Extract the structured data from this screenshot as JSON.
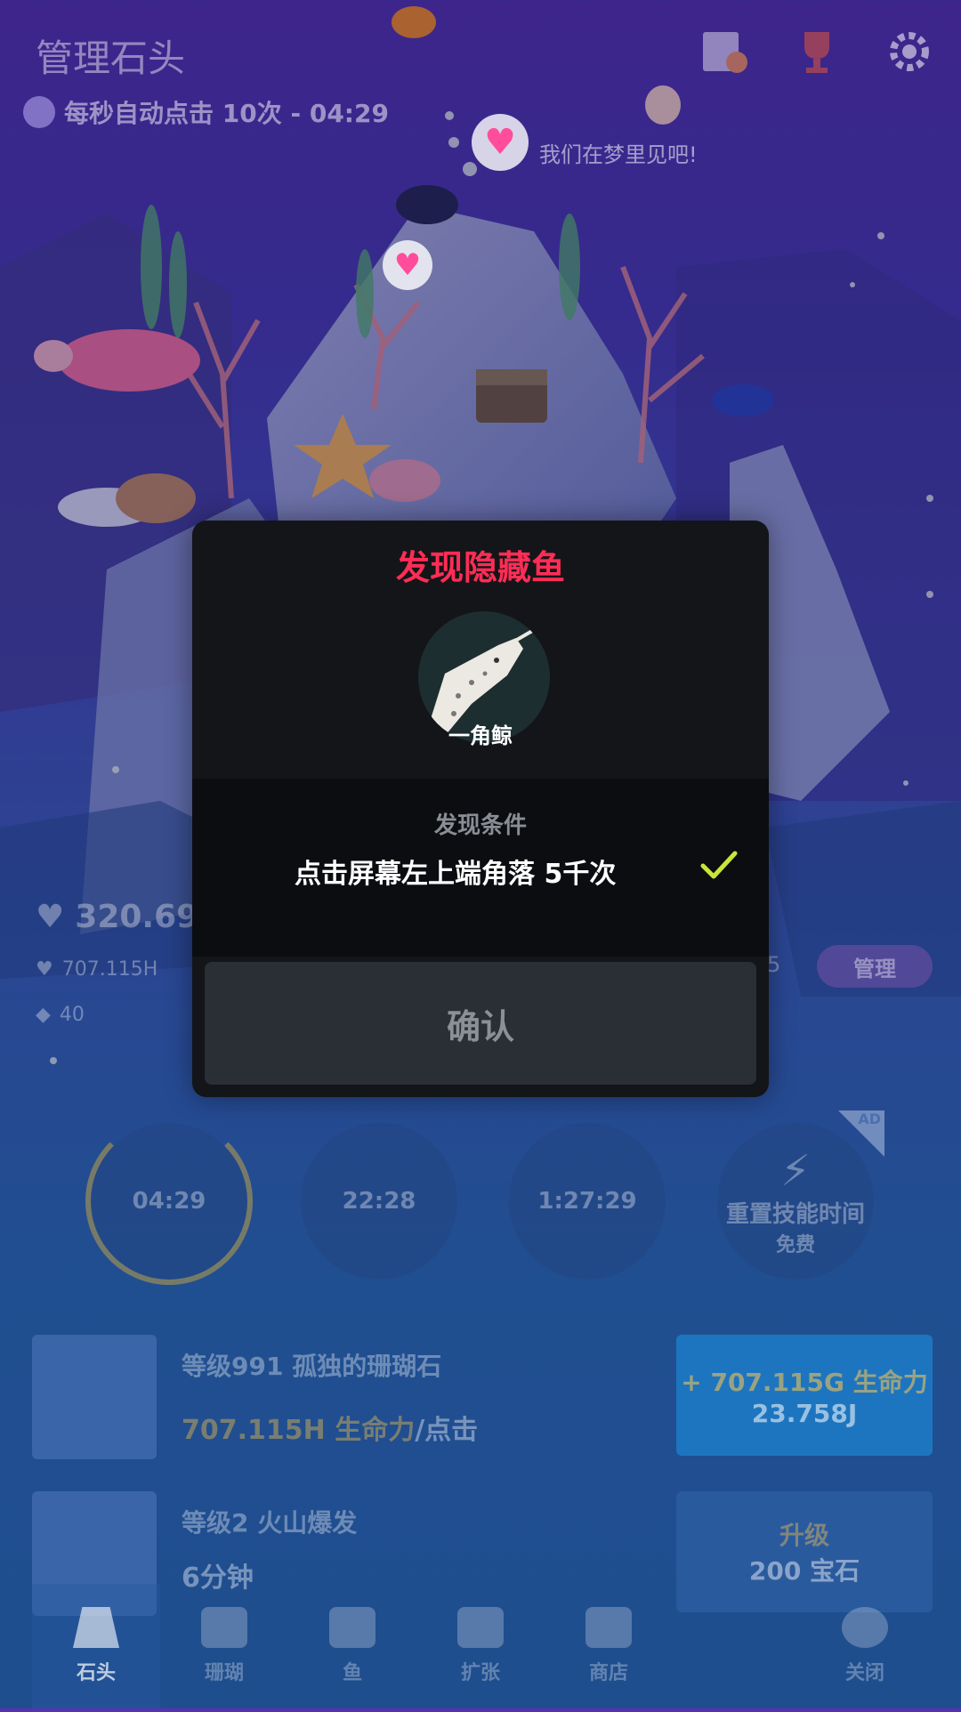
{
  "header": {
    "title": "管理石头",
    "auto_click": "每秒自动点击 10次 - 04:29"
  },
  "speech": "我们在梦里见吧!",
  "stats": {
    "life": "320.69",
    "per_tap": "707.115H",
    "gems": "40",
    "right_value": "5",
    "manage_label": "管理"
  },
  "skills": [
    {
      "label": "04:29"
    },
    {
      "label": "22:28"
    },
    {
      "label": "1:27:29"
    },
    {
      "label": "重置技能时间",
      "sub": "免费",
      "ad": "AD"
    }
  ],
  "upgrades": [
    {
      "name": "等级991 孤独的珊瑚石",
      "value": "707.115H 生命力",
      "value_suffix": "/点击",
      "btn_line1": "+ 707.115G 生命力",
      "btn_line2": "23.758J"
    },
    {
      "name": "等级2 火山爆发",
      "value": "6分钟",
      "btn_line1": "升级",
      "btn_line2": "200 宝石"
    }
  ],
  "nav": {
    "stone": "石头",
    "coral": "珊瑚",
    "fish": "鱼",
    "expand": "扩张",
    "shop": "商店",
    "close": "关闭"
  },
  "modal": {
    "title": "发现隐藏鱼",
    "fish_name": "一角鲸",
    "condition_label": "发现条件",
    "condition_text": "点击屏幕左上端角落 5千次",
    "confirm": "确认"
  },
  "colors": {
    "modal_title": "#ff2d55",
    "check": "#c8e639",
    "modal_bg": "#131519"
  }
}
